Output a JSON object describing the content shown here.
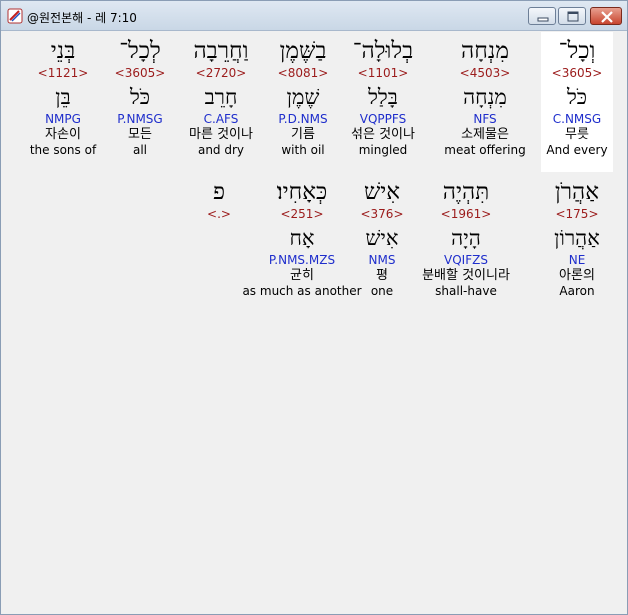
{
  "window": {
    "title": "@원전본해 - 레 7:10"
  },
  "rows": [
    {
      "words": [
        {
          "hebrew": "וְכָל־",
          "strong": "<3605>",
          "lemma": "כֹּל",
          "morph": "C.NMSG",
          "korean": "무릇",
          "english": "And every",
          "selected": true
        },
        {
          "hebrew": "מִנְחָה",
          "strong": "<4503>",
          "lemma": "מִנְחָה",
          "morph": "NFS",
          "korean": "소제물은",
          "english": "meat offering",
          "selected": false
        },
        {
          "hebrew": "בְלוּלָה־",
          "strong": "<1101>",
          "lemma": "בָּלַל",
          "morph": "VQPPFS",
          "korean": "섞은 것이나",
          "english": "mingled",
          "selected": false
        },
        {
          "hebrew": "בַשֶּׁמֶן",
          "strong": "<8081>",
          "lemma": "שֶׁמֶן",
          "morph": "P.D.NMS",
          "korean": "기름",
          "english": "with oil",
          "selected": false
        },
        {
          "hebrew": "וַחֲרֵבָה",
          "strong": "<2720>",
          "lemma": "חָרֵב",
          "morph": "C.AFS",
          "korean": "마른 것이나",
          "english": "and dry",
          "selected": false
        },
        {
          "hebrew": "לְכָל־",
          "strong": "<3605>",
          "lemma": "כֹּל",
          "morph": "P.NMSG",
          "korean": "모든",
          "english": "all",
          "selected": false
        },
        {
          "hebrew": "בְּנֵי",
          "strong": "<1121>",
          "lemma": "בֵּן",
          "morph": "NMPG",
          "korean": "자손이",
          "english": "the sons of",
          "selected": false
        }
      ]
    },
    {
      "words": [
        {
          "hebrew": "אַהֲרֹן",
          "strong": "<175>",
          "lemma": "אַהֲרוֹן",
          "morph": "NE",
          "korean": "아론의",
          "english": "Aaron",
          "selected": false
        },
        {
          "hebrew": "תִּהְיֶה",
          "strong": "<1961>",
          "lemma": "הָיָה",
          "morph": "VQIFZS",
          "korean": "분배할 것이니라",
          "english": "shall-have",
          "selected": false
        },
        {
          "hebrew": "אִישׁ",
          "strong": "<376>",
          "lemma": "אִישׁ",
          "morph": "NMS",
          "korean": "평",
          "english": "one",
          "selected": false
        },
        {
          "hebrew": "כְּאָחִיו׃",
          "strong": "<251>",
          "lemma": "אָח",
          "morph": "P.NMS.MZS",
          "korean": "균히",
          "english": "as much as another",
          "selected": false
        },
        {
          "hebrew": "פ",
          "strong": "<.>",
          "lemma": "",
          "morph": "",
          "korean": "",
          "english": "",
          "selected": false
        }
      ]
    }
  ]
}
